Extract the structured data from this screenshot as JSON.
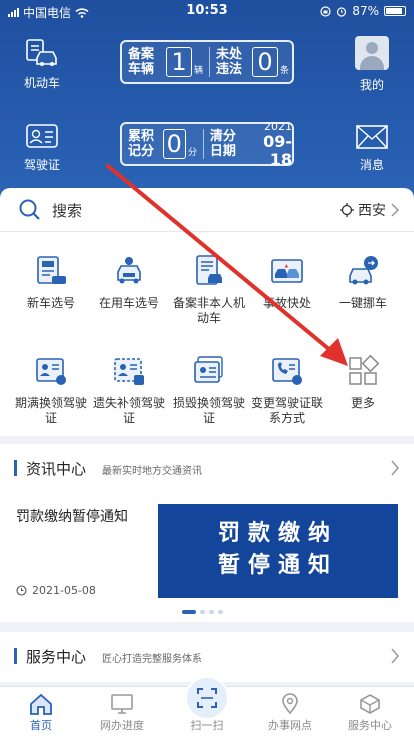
{
  "status_bar": {
    "carrier": "中国电信",
    "time": "10:53",
    "battery": "87%"
  },
  "header": {
    "vehicle_label": "机动车",
    "license_label": "驾驶证",
    "profile_label": "我的",
    "message_label": "消息",
    "vehicle_panel": {
      "registered_label": "备案车辆",
      "registered_count": "1",
      "registered_unit": "辆",
      "violations_label": "未处违法",
      "violations_count": "0",
      "violations_unit": "条"
    },
    "license_panel": {
      "points_label": "累积记分",
      "points_value": "0",
      "points_unit": "分",
      "clear_label": "清分日期",
      "clear_year": "2021",
      "clear_date": "09-18"
    }
  },
  "search": {
    "placeholder": "搜索",
    "city": "西安"
  },
  "services": [
    {
      "label": "新车选号",
      "icon": "new-car-icon"
    },
    {
      "label": "在用车选号",
      "icon": "car-number-icon"
    },
    {
      "label": "备案非本人机动车",
      "icon": "register-vehicle-icon"
    },
    {
      "label": "事故快处",
      "icon": "accident-icon"
    },
    {
      "label": "一键挪车",
      "icon": "move-car-icon"
    },
    {
      "label": "期满换领驾驶证",
      "icon": "license-renew-icon"
    },
    {
      "label": "遗失补领驾驶证",
      "icon": "license-lost-icon"
    },
    {
      "label": "损毁换领驾驶证",
      "icon": "license-damaged-icon"
    },
    {
      "label": "变更驾驶证联系方式",
      "icon": "license-contact-icon"
    },
    {
      "label": "更多",
      "icon": "more-icon"
    }
  ],
  "news": {
    "title": "资讯中心",
    "subtitle": "最新实时地方交通资讯",
    "item_title": "罚款缴纳暂停通知",
    "item_date": "2021-05-08",
    "banner_line1": "罚款缴纳",
    "banner_line2": "暂停通知"
  },
  "service_center": {
    "title": "服务中心",
    "subtitle": "匠心打造完整服务体系"
  },
  "tabs": [
    {
      "label": "首页",
      "active": true
    },
    {
      "label": "网办进度",
      "active": false
    },
    {
      "label": "扫一扫",
      "active": false
    },
    {
      "label": "办事网点",
      "active": false
    },
    {
      "label": "服务中心",
      "active": false
    }
  ],
  "colors": {
    "header_blue": "#2a5ea9",
    "accent": "#2a62b4",
    "arrow": "#e0312b"
  }
}
